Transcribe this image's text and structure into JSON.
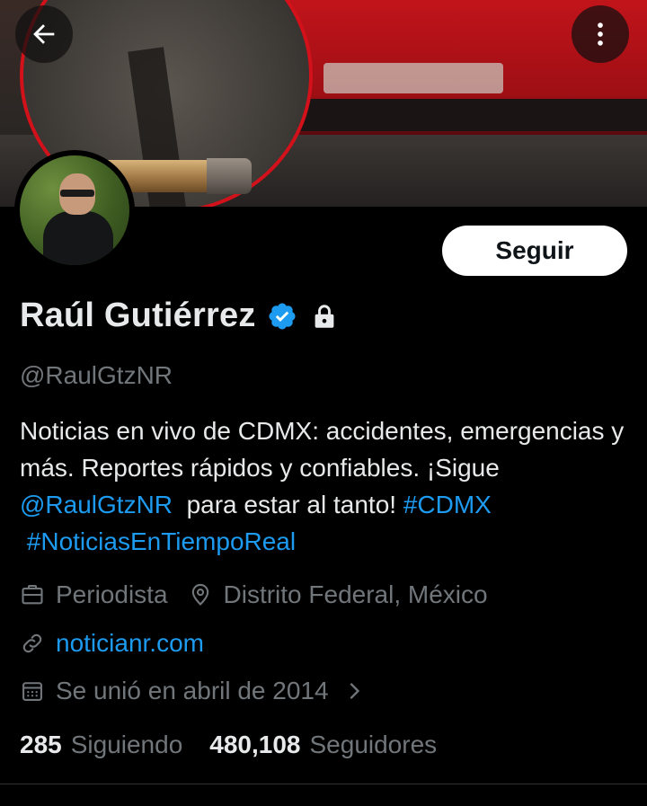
{
  "header": {
    "back_icon": "arrow-left-icon",
    "more_icon": "vertical-ellipsis-icon"
  },
  "profile": {
    "name": "Raúl Gutiérrez",
    "verified_icon": "verified-badge-icon",
    "protected_icon": "lock-icon",
    "handle": "@RaulGtzNR",
    "follow_label": "Seguir",
    "bio": {
      "part1": "Noticias en vivo de CDMX: accidentes, emergencias y más. Reportes rápidos y confiables. ¡Sigue ",
      "mention": "@RaulGtzNR",
      "part2": "  para estar al tanto! ",
      "hashtag1": "#CDMX",
      "space": " ",
      "hashtag2": "#NoticiasEnTiempoReal"
    },
    "profession": "Periodista",
    "location": "Distrito Federal, México",
    "website": "noticianr.com",
    "joined": "Se unió en abril de 2014",
    "following_count": "285",
    "following_label": "Siguiendo",
    "followers_count": "480,108",
    "followers_label": "Seguidores"
  },
  "colors": {
    "background": "#000000",
    "text_primary": "#e7e9ea",
    "text_secondary": "#71767b",
    "link": "#1d9bf0",
    "verified": "#1d9bf0"
  }
}
